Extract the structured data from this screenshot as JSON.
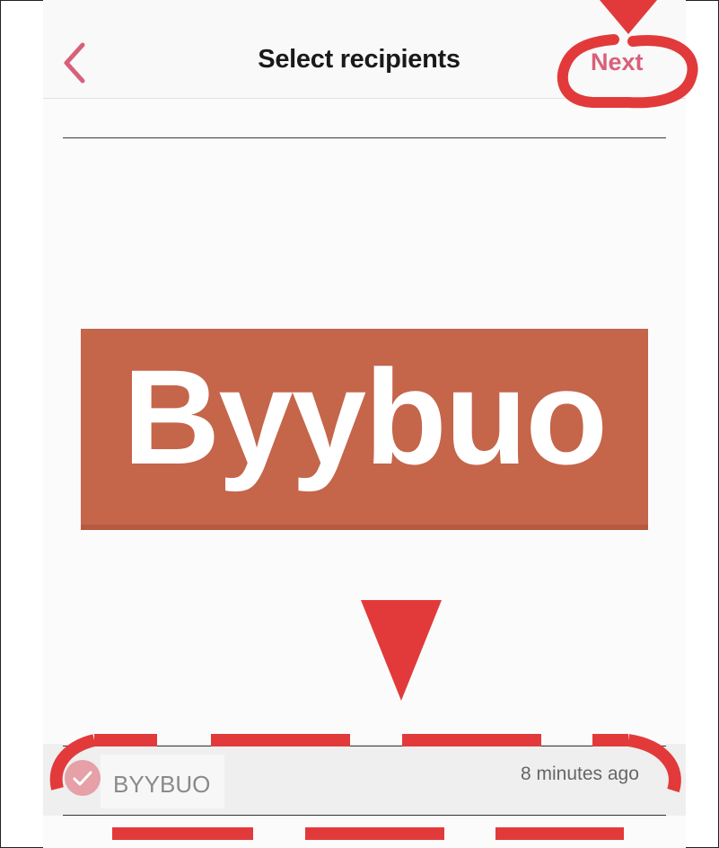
{
  "header": {
    "title": "Select recipients",
    "next_label": "Next"
  },
  "logo": {
    "text": "Byybuo"
  },
  "recipient": {
    "name": "BYYBUO",
    "time": "8 minutes ago"
  },
  "colors": {
    "accent": "#d8607a",
    "logo_bg": "#c5654a",
    "annotation": "#e23a3a"
  },
  "icons": {
    "back": "chevron-left-icon",
    "check": "checkmark-icon"
  }
}
